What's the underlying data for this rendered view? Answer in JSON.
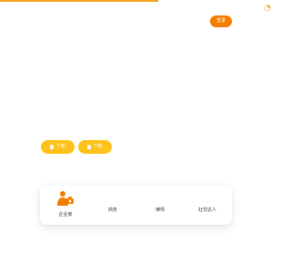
{
  "header": {
    "button_label": "登录"
  },
  "download": {
    "android_label": "下载",
    "ios_label": "下载"
  },
  "roles": [
    {
      "label": "企业家"
    },
    {
      "label": "商务"
    },
    {
      "label": "律师"
    },
    {
      "label": "社交达人"
    }
  ],
  "theme": {
    "orange": "#f57c00",
    "yellow": "#ffc21a",
    "accent": "#f5a623"
  }
}
